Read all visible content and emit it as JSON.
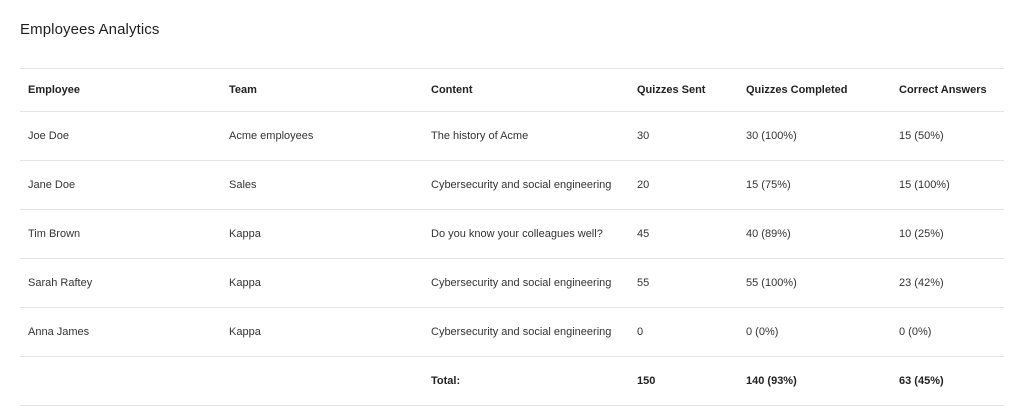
{
  "page": {
    "title": "Employees Analytics"
  },
  "table": {
    "headers": {
      "employee": "Employee",
      "team": "Team",
      "content": "Content",
      "quizzes_sent": "Quizzes Sent",
      "quizzes_completed": "Quizzes Completed",
      "correct_answers": "Correct Answers"
    },
    "rows": [
      {
        "employee": "Joe Doe",
        "team": "Acme employees",
        "content": "The history of Acme",
        "quizzes_sent": "30",
        "quizzes_completed": "30 (100%)",
        "correct_answers": "15 (50%)"
      },
      {
        "employee": "Jane Doe",
        "team": "Sales",
        "content": "Cybersecurity and social engineering",
        "quizzes_sent": "20",
        "quizzes_completed": "15 (75%)",
        "correct_answers": "15 (100%)"
      },
      {
        "employee": "Tim Brown",
        "team": "Kappa",
        "content": "Do you know your colleagues well?",
        "quizzes_sent": "45",
        "quizzes_completed": "40 (89%)",
        "correct_answers": "10 (25%)"
      },
      {
        "employee": "Sarah Raftey",
        "team": "Kappa",
        "content": "Cybersecurity and social engineering",
        "quizzes_sent": "55",
        "quizzes_completed": "55 (100%)",
        "correct_answers": "23 (42%)"
      },
      {
        "employee": "Anna James",
        "team": "Kappa",
        "content": "Cybersecurity and social engineering",
        "quizzes_sent": "0",
        "quizzes_completed": "0 (0%)",
        "correct_answers": "0 (0%)"
      }
    ],
    "totals": {
      "label": "Total:",
      "quizzes_sent": "150",
      "quizzes_completed": "140 (93%)",
      "correct_answers": "63 (45%)"
    }
  }
}
